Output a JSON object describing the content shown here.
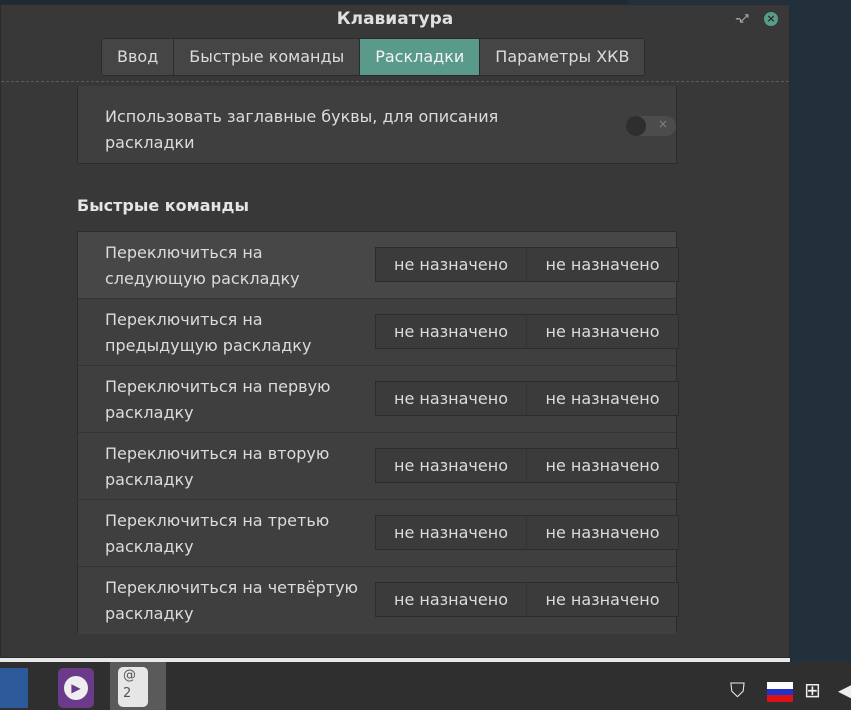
{
  "window": {
    "title": "Клавиатура"
  },
  "tabs": [
    {
      "label": "Ввод"
    },
    {
      "label": "Быстрые команды"
    },
    {
      "label": "Раскладки",
      "active": true
    },
    {
      "label": "Параметры ХКВ"
    }
  ],
  "capitals_option": {
    "label": "Использовать заглавные буквы, для описания раскладки",
    "enabled": false
  },
  "shortcuts": {
    "heading": "Быстрые команды",
    "rows": [
      {
        "label": "Переключиться на следующую раскладку",
        "primary": "не назначено",
        "secondary": "не назначено"
      },
      {
        "label": "Переключиться на предыдущую раскладку",
        "primary": "не назначено",
        "secondary": "не назначено"
      },
      {
        "label": "Переключиться на первую раскладку",
        "primary": "не назначено",
        "secondary": "не назначено"
      },
      {
        "label": "Переключиться на вторую раскладку",
        "primary": "не назначено",
        "secondary": "не назначено"
      },
      {
        "label": "Переключиться на третью раскладку",
        "primary": "не назначено",
        "secondary": "не назначено"
      },
      {
        "label": "Переключиться на четвёртую раскладку",
        "primary": "не назначено",
        "secondary": "не назначено"
      }
    ]
  },
  "taskbar": {
    "workspace_label": "@\n2"
  },
  "colors": {
    "accent": "#5a9a8b"
  }
}
